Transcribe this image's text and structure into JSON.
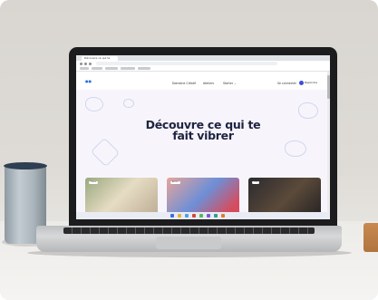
{
  "browser": {
    "tab_title": "Découvre ce qui te",
    "url": ""
  },
  "site": {
    "logo_text": "ID\nSUB",
    "nav": {
      "link1": "Domaine Créatif",
      "link2": "Ateliers",
      "link3": "Starter ⌄",
      "login": "Se connecter",
      "signup": "Rejoindre"
    },
    "headline_line1": "Découvre ce qui te",
    "headline_line2": "fait vibrer",
    "subtext": "",
    "cards": [
      {
        "label": "Cours"
      },
      {
        "label": "Atelier"
      },
      {
        "label": "Live"
      }
    ]
  },
  "colors": {
    "accent": "#3b4ed8",
    "headline": "#1e2340",
    "background": "#f7f5fb"
  }
}
